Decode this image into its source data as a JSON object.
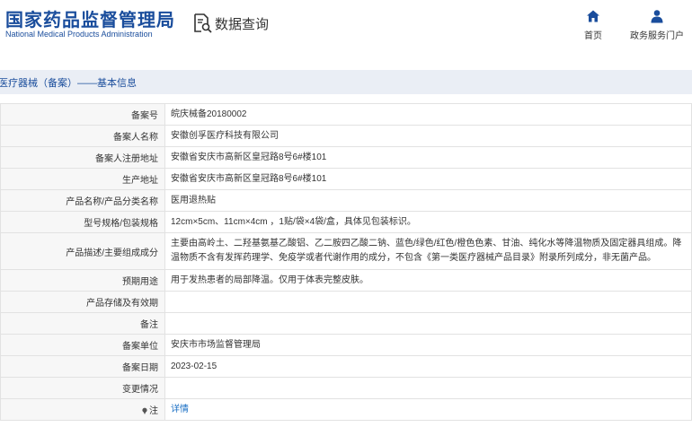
{
  "header": {
    "logo_cn": "国家药品监督管理局",
    "logo_en": "National Medical Products Administration",
    "section_title": "数据查询",
    "nav": [
      {
        "label": "首页",
        "icon": "home-icon"
      },
      {
        "label": "政务服务门户",
        "icon": "user-icon"
      }
    ]
  },
  "breadcrumb": "医疗器械（备案）——基本信息",
  "rows": [
    {
      "label": "备案号",
      "value": "皖庆械备20180002"
    },
    {
      "label": "备案人名称",
      "value": "安徽创孚医疗科技有限公司"
    },
    {
      "label": "备案人注册地址",
      "value": "安徽省安庆市高新区皇冠路8号6#楼101"
    },
    {
      "label": "生产地址",
      "value": "安徽省安庆市高新区皇冠路8号6#楼101"
    },
    {
      "label": "产品名称/产品分类名称",
      "value": "医用退热贴"
    },
    {
      "label": "型号规格/包装规格",
      "value": "12cm×5cm、11cm×4cm ，1贴/袋×4袋/盒，具体见包装标识。"
    },
    {
      "label": "产品描述/主要组成成分",
      "value": "主要由高岭土、二羟基氨基乙酸铝、乙二胺四乙酸二钠、蓝色/绿色/红色/橙色色素、甘油、纯化水等降温物质及固定器具组成。降温物质不含有发挥药理学、免疫学或者代谢作用的成分，不包含《第一类医疗器械产品目录》附录所列成分，非无菌产品。"
    },
    {
      "label": "预期用途",
      "value": "用于发热患者的局部降温。仅用于体表完整皮肤。"
    },
    {
      "label": "产品存储及有效期",
      "value": ""
    },
    {
      "label": "备注",
      "value": ""
    },
    {
      "label": "备案单位",
      "value": "安庆市市场监督管理局"
    },
    {
      "label": "备案日期",
      "value": "2023-02-15"
    },
    {
      "label": "变更情况",
      "value": ""
    },
    {
      "label": "注",
      "value": "详情",
      "is_link": true
    }
  ],
  "colors": {
    "brand": "#1a4d9c",
    "link": "#1a6fc4",
    "title_bar": "#eaeef5",
    "label_bg": "#f7f7f7"
  }
}
